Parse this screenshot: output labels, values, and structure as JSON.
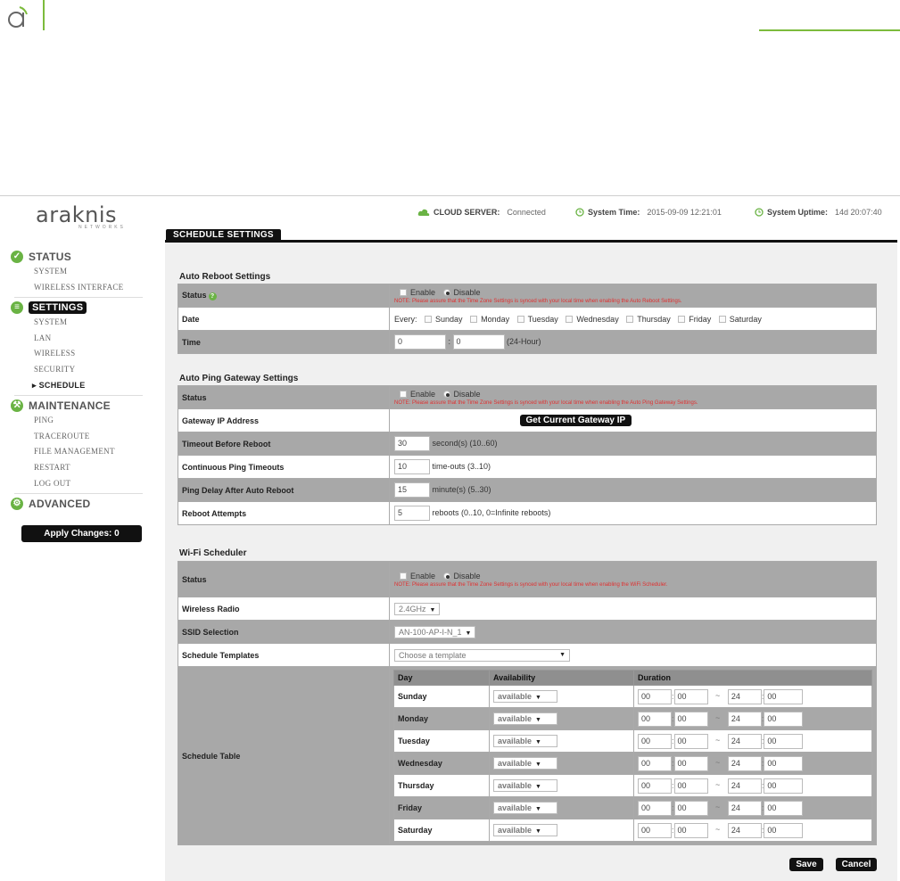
{
  "brand": {
    "name": "araknis",
    "sub": "NETWORKS"
  },
  "topbar": {
    "cloud_label": "CLOUD SERVER:",
    "cloud_value": "Connected",
    "time_label": "System Time:",
    "time_value": "2015-09-09 12:21:01",
    "uptime_label": "System Uptime:",
    "uptime_value": "14d 20:07:40"
  },
  "sidebar": {
    "status": {
      "label": "STATUS",
      "items": [
        "SYSTEM",
        "WIRELESS INTERFACE"
      ]
    },
    "settings": {
      "label": "SETTINGS",
      "items": [
        "SYSTEM",
        "LAN",
        "WIRELESS",
        "SECURITY"
      ],
      "current": "▸ SCHEDULE"
    },
    "maintenance": {
      "label": "MAINTENANCE",
      "items": [
        "PING",
        "TRACEROUTE",
        "FILE MANAGEMENT",
        "RESTART",
        "LOG OUT"
      ]
    },
    "advanced": {
      "label": "ADVANCED"
    },
    "apply": "Apply Changes: 0"
  },
  "page_title": "SCHEDULE SETTINGS",
  "reboot": {
    "title": "Auto Reboot Settings",
    "status_label": "Status",
    "enable": "Enable",
    "disable": "Disable",
    "note": "NOTE: Please assure that the Time Zone Settings is synced with your local time when enabling the Auto Reboot Settings.",
    "date_label": "Date",
    "every": "Every:",
    "days": [
      "Sunday",
      "Monday",
      "Tuesday",
      "Wednesday",
      "Thursday",
      "Friday",
      "Saturday"
    ],
    "time_label": "Time",
    "hour": "0",
    "minute": "0",
    "time_unit": "(24-Hour)"
  },
  "ping": {
    "title": "Auto Ping Gateway Settings",
    "status_label": "Status",
    "enable": "Enable",
    "disable": "Disable",
    "note": "NOTE: Please assure that the Time Zone Settings is synced with your local time when enabling the Auto Ping Gateway Settings.",
    "gateway_label": "Gateway IP Address",
    "gateway_value": "",
    "gateway_button": "Get Current Gateway IP",
    "timeout_label": "Timeout Before Reboot",
    "timeout_value": "30",
    "timeout_unit": "second(s) (10..60)",
    "continuous_label": "Continuous Ping Timeouts",
    "continuous_value": "10",
    "continuous_unit": "time-outs (3..10)",
    "delay_label": "Ping Delay After Auto Reboot",
    "delay_value": "15",
    "delay_unit": "minute(s) (5..30)",
    "attempts_label": "Reboot Attempts",
    "attempts_value": "5",
    "attempts_unit": "reboots (0..10, 0=Infinite reboots)"
  },
  "wifi": {
    "title": "Wi-Fi Scheduler",
    "status_label": "Status",
    "enable": "Enable",
    "disable": "Disable",
    "note": "NOTE: Please assure that the Time Zone Settings is synced with your local time when enabling the WiFi Scheduler.",
    "radio_label": "Wireless Radio",
    "radio_value": "2.4GHz",
    "ssid_label": "SSID Selection",
    "ssid_value": "AN-100-AP-I-N_1",
    "templates_label": "Schedule Templates",
    "templates_placeholder": "Choose a template",
    "table_label": "Schedule Table",
    "headers": {
      "day": "Day",
      "availability": "Availability",
      "duration": "Duration"
    },
    "rows": [
      {
        "day": "Sunday",
        "availability": "available",
        "start_h": "00",
        "start_m": "00",
        "end_h": "24",
        "end_m": "00"
      },
      {
        "day": "Monday",
        "availability": "available",
        "start_h": "00",
        "start_m": "00",
        "end_h": "24",
        "end_m": "00"
      },
      {
        "day": "Tuesday",
        "availability": "available",
        "start_h": "00",
        "start_m": "00",
        "end_h": "24",
        "end_m": "00"
      },
      {
        "day": "Wednesday",
        "availability": "available",
        "start_h": "00",
        "start_m": "00",
        "end_h": "24",
        "end_m": "00"
      },
      {
        "day": "Thursday",
        "availability": "available",
        "start_h": "00",
        "start_m": "00",
        "end_h": "24",
        "end_m": "00"
      },
      {
        "day": "Friday",
        "availability": "available",
        "start_h": "00",
        "start_m": "00",
        "end_h": "24",
        "end_m": "00"
      },
      {
        "day": "Saturday",
        "availability": "available",
        "start_h": "00",
        "start_m": "00",
        "end_h": "24",
        "end_m": "00"
      }
    ],
    "range_sep": "~",
    "time_sep": ":"
  },
  "actions": {
    "save": "Save",
    "cancel": "Cancel"
  },
  "colors": {
    "accent_green": "#6ab344",
    "header_dark": "#111111",
    "note_red": "#e03030"
  }
}
